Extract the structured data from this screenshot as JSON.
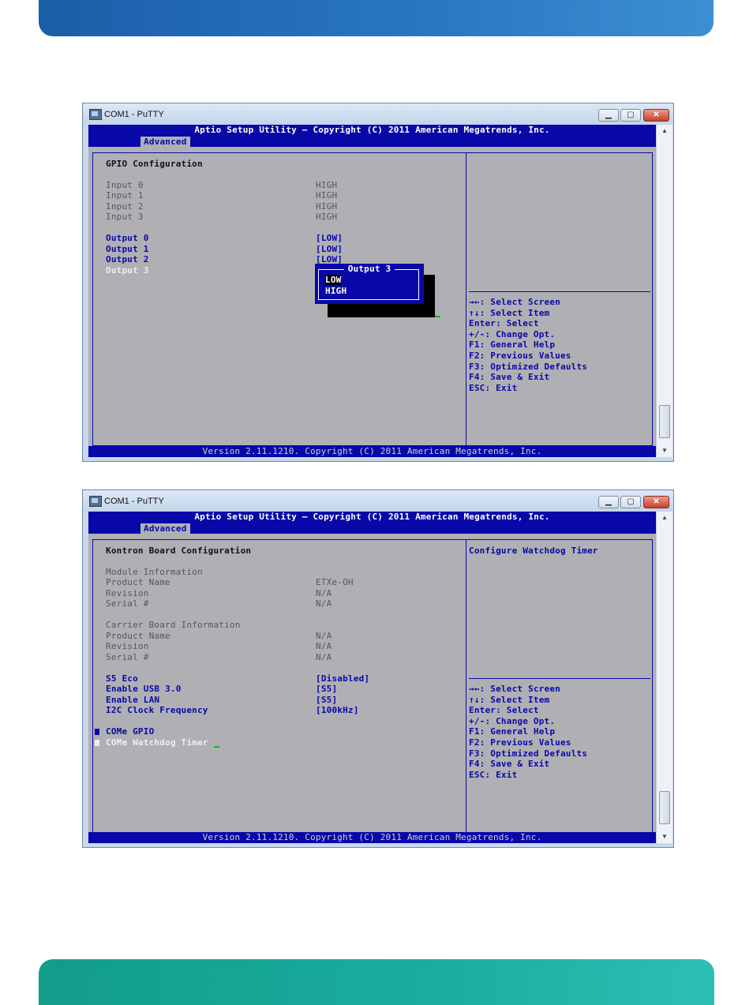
{
  "windows": [
    {
      "title": "COM1 - PuTTY",
      "header_title": "Aptio Setup Utility – Copyright (C) 2011 American Megatrends, Inc.",
      "tab": "Advanced",
      "footer": "Version 2.11.1210. Copyright (C) 2011 American Megatrends, Inc.",
      "section_title": "GPIO Configuration",
      "inputs": [
        {
          "label": "Input 0",
          "value": "HIGH"
        },
        {
          "label": "Input 1",
          "value": "HIGH"
        },
        {
          "label": "Input 2",
          "value": "HIGH"
        },
        {
          "label": "Input 3",
          "value": "HIGH"
        }
      ],
      "outputs": [
        {
          "label": "Output 0",
          "value": "[LOW]"
        },
        {
          "label": "Output 1",
          "value": "[LOW]"
        },
        {
          "label": "Output 2",
          "value": "[LOW]"
        },
        {
          "label": "Output 3",
          "value": ""
        }
      ],
      "popup": {
        "title": "Output 3",
        "options": [
          "LOW",
          "HIGH"
        ],
        "selected": "LOW"
      },
      "help": [
        "→←: Select Screen",
        "↑↓: Select Item",
        "Enter: Select",
        "+/-: Change Opt.",
        "F1: General Help",
        "F2: Previous Values",
        "F3: Optimized Defaults",
        "F4: Save & Exit",
        "ESC: Exit"
      ]
    },
    {
      "title": "COM1 - PuTTY",
      "header_title": "Aptio Setup Utility – Copyright (C) 2011 American Megatrends, Inc.",
      "tab": "Advanced",
      "footer": "Version 2.11.1210. Copyright (C) 2011 American Megatrends, Inc.",
      "section_title": "Kontron Board Configuration",
      "description": "Configure Watchdog Timer",
      "module_info": {
        "heading": "Module Information",
        "rows": [
          {
            "label": "Product Name",
            "value": "ETXe-OH"
          },
          {
            "label": "Revision",
            "value": "N/A"
          },
          {
            "label": "Serial #",
            "value": "N/A"
          }
        ]
      },
      "carrier_info": {
        "heading": "Carrier Board Information",
        "rows": [
          {
            "label": "Product Name",
            "value": "N/A"
          },
          {
            "label": "Revision",
            "value": "N/A"
          },
          {
            "label": "Serial #",
            "value": "N/A"
          }
        ]
      },
      "settings": [
        {
          "label": "S5 Eco",
          "value": "[Disabled]"
        },
        {
          "label": "Enable USB 3.0",
          "value": "[S5]"
        },
        {
          "label": "Enable LAN",
          "value": "[S5]"
        },
        {
          "label": "I2C Clock Frequency",
          "value": "[100kHz]"
        }
      ],
      "submenus": [
        "COMe GPIO",
        "COMe Watchdog Timer"
      ],
      "help": [
        "→←: Select Screen",
        "↑↓: Select Item",
        "Enter: Select",
        "+/-: Change Opt.",
        "F1: General Help",
        "F2: Previous Values",
        "F3: Optimized Defaults",
        "F4: Save & Exit",
        "ESC: Exit"
      ]
    }
  ],
  "icons": {
    "app": "putty-icon",
    "minimize": "minimize-icon",
    "maximize": "maximize-icon",
    "close": "close-icon"
  },
  "colors": {
    "bios_blue": "#0808a8",
    "bios_gray": "#b0b0b4",
    "top_banner": "#2a78c2",
    "bottom_banner": "#1aaea0"
  }
}
